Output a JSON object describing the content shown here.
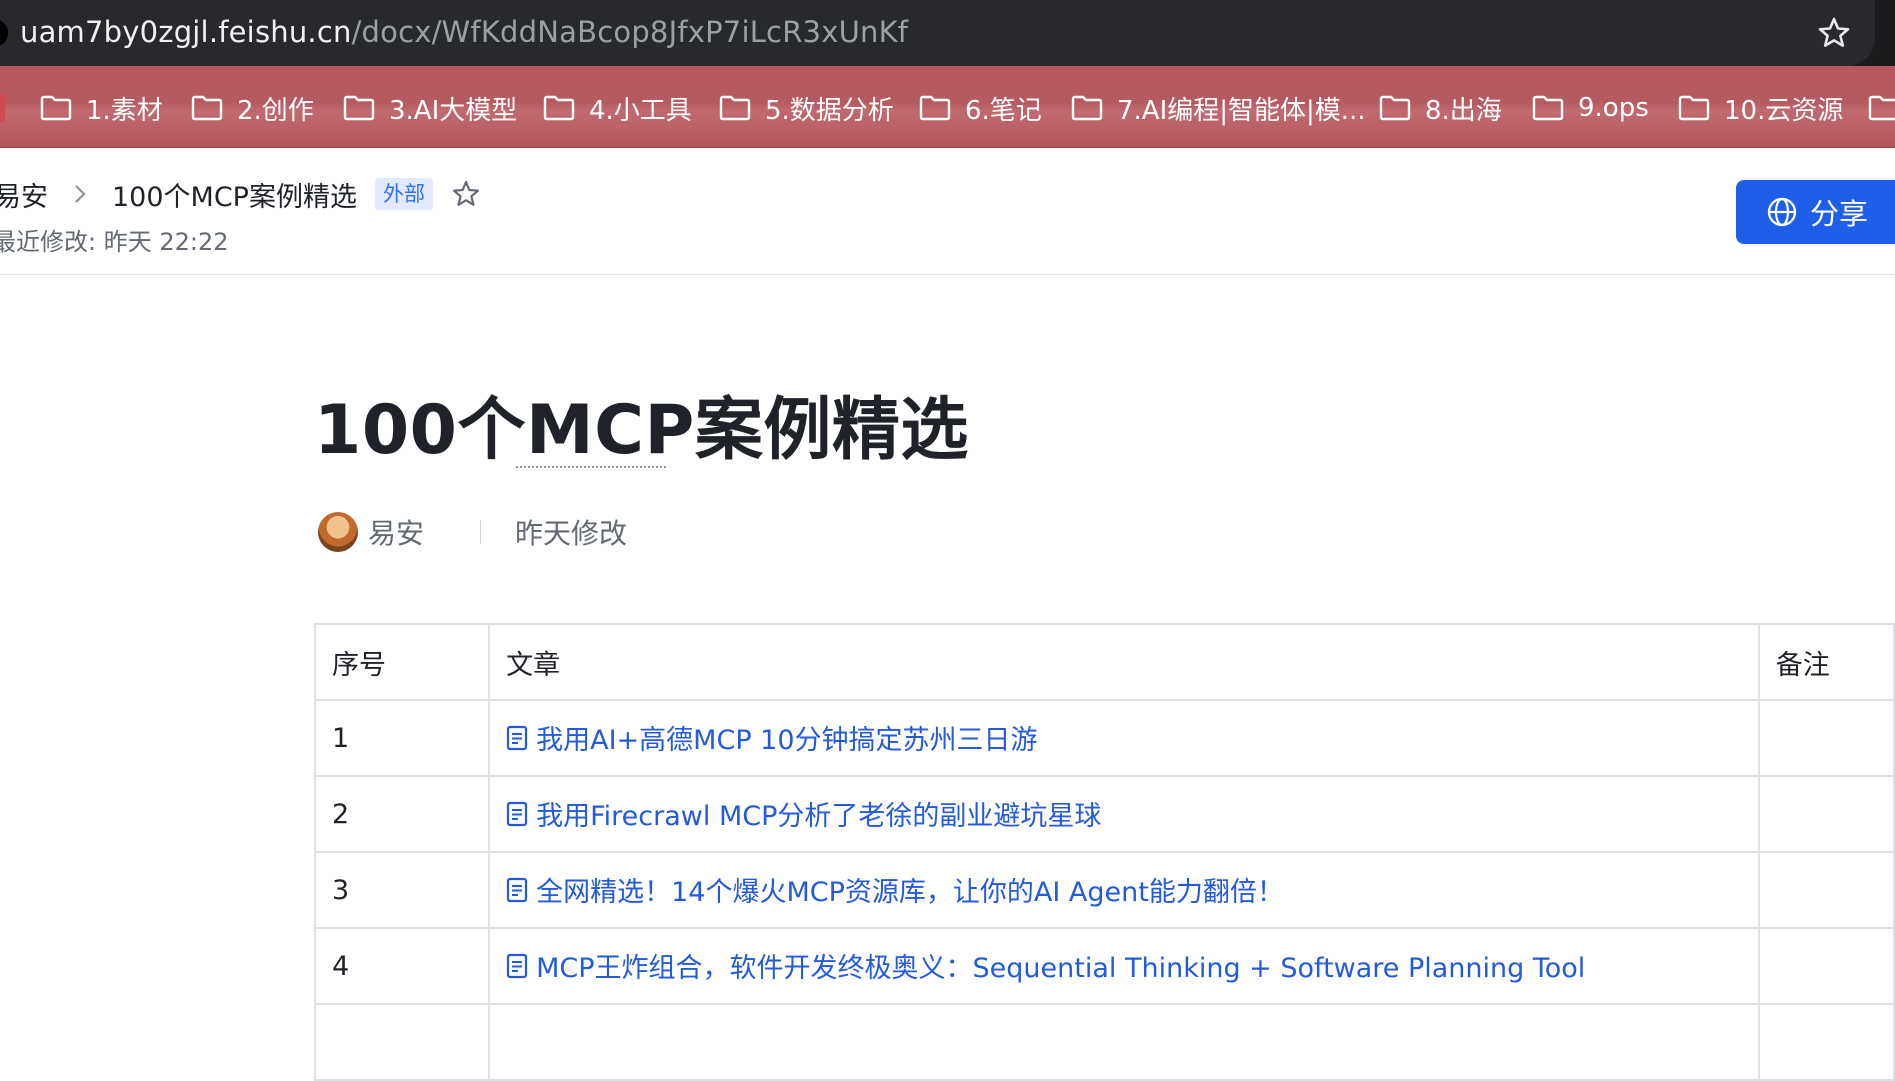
{
  "browser": {
    "url_host": "uam7by0zgjl.feishu.cn",
    "url_path": "/docx/WfKddNaBcop8JfxP7iLcR3xUnKf"
  },
  "bookmarks": [
    {
      "label": "1.素材",
      "icon": "folder-icon"
    },
    {
      "label": "2.创作",
      "icon": "folder-icon"
    },
    {
      "label": "3.AI大模型",
      "icon": "folder-icon"
    },
    {
      "label": "4.小工具",
      "icon": "folder-icon"
    },
    {
      "label": "5.数据分析",
      "icon": "folder-icon"
    },
    {
      "label": "6.笔记",
      "icon": "folder-icon"
    },
    {
      "label": "7.AI编程|智能体|模...",
      "icon": "folder-icon"
    },
    {
      "label": "8.出海",
      "icon": "folder-icon"
    },
    {
      "label": "9.ops",
      "icon": "folder-icon"
    },
    {
      "label": "10.云资源",
      "icon": "folder-icon"
    }
  ],
  "header": {
    "breadcrumb_root": "易安",
    "breadcrumb_current": "100个MCP案例精选",
    "badge": "外部",
    "last_modified": "最近修改: 昨天 22:22",
    "share_label": "分享"
  },
  "doc": {
    "title": "100个MCP案例精选",
    "author": "易安",
    "edit_time": "昨天修改"
  },
  "table": {
    "headers": [
      "序号",
      "文章",
      "备注"
    ],
    "rows": [
      {
        "index": "1",
        "article": "我用AI+高德MCP 10分钟搞定苏州三日游"
      },
      {
        "index": "2",
        "article": "我用Firecrawl MCP分析了老徐的副业避坑星球"
      },
      {
        "index": "3",
        "article": "全网精选！14个爆火MCP资源库，让你的AI Agent能力翻倍！"
      },
      {
        "index": "4",
        "article": "MCP王炸组合，软件开发终极奥义：Sequential Thinking + Software Planning Tool"
      }
    ]
  },
  "colors": {
    "accent": "#1f5ee8",
    "link": "#245bdb",
    "bookmark_bar": "#b8585e"
  }
}
